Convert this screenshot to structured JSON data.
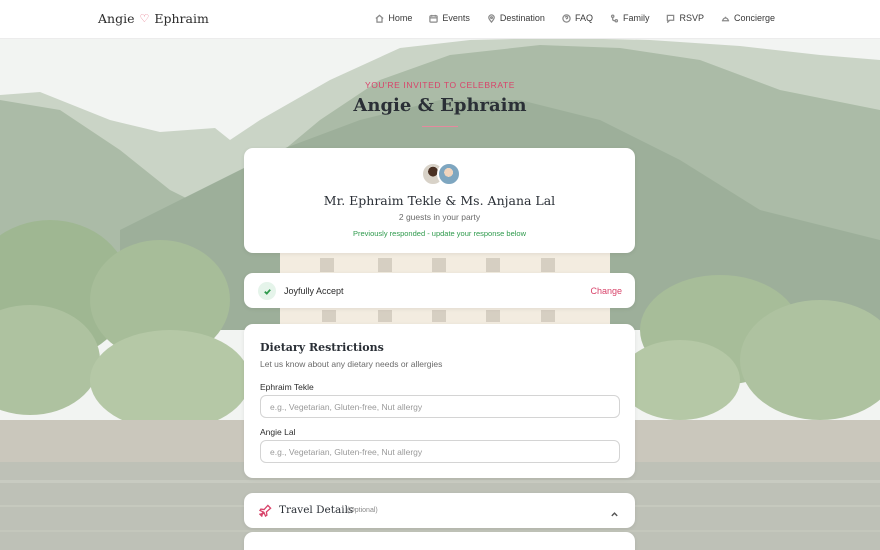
{
  "nav": {
    "brand_left": "Angie",
    "brand_right": "Ephraim",
    "items": [
      {
        "label": "Home",
        "icon": "home-icon"
      },
      {
        "label": "Events",
        "icon": "calendar-icon"
      },
      {
        "label": "Destination",
        "icon": "map-pin-icon"
      },
      {
        "label": "FAQ",
        "icon": "help-circle-icon"
      },
      {
        "label": "Family",
        "icon": "family-tree-icon"
      },
      {
        "label": "RSVP",
        "icon": "message-icon"
      },
      {
        "label": "Concierge",
        "icon": "concierge-bell-icon"
      }
    ]
  },
  "hero": {
    "eyebrow": "YOU'RE INVITED TO CELEBRATE",
    "title": "Angie & Ephraim"
  },
  "guest": {
    "name": "Mr. Ephraim Tekle & Ms. Anjana Lal",
    "count": "2 guests in your party",
    "status": "Previously responded - update your response below"
  },
  "response": {
    "label": "Joyfully Accept",
    "change": "Change"
  },
  "dietary": {
    "title": "Dietary Restrictions",
    "subtitle": "Let us know about any dietary needs or allergies",
    "fields": [
      {
        "label": "Ephraim Tekle",
        "placeholder": "e.g., Vegetarian, Gluten-free, Nut allergy",
        "value": ""
      },
      {
        "label": "Angie Lal",
        "placeholder": "e.g., Vegetarian, Gluten-free, Nut allergy",
        "value": ""
      }
    ]
  },
  "travel": {
    "title": "Travel Details",
    "optional": "(Optional)"
  },
  "colors": {
    "accent": "#d8436a",
    "success": "#2e9a4c"
  }
}
